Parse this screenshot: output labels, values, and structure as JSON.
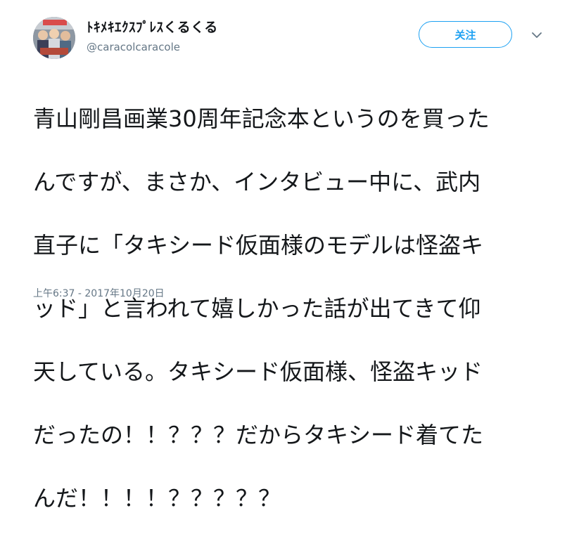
{
  "user": {
    "display_name": "ﾄｷﾒｷｴｸｽﾌﾟﾚｽくるくる",
    "handle": "@caracolcaracole"
  },
  "actions": {
    "follow_label": "关注",
    "menu_icon": "chevron-down-icon"
  },
  "tweet": {
    "lines": [
      "青山剛昌画業30周年記念本というのを買った",
      "んですが、まさか、インタビュー中に、武内",
      "直子に「タキシード仮面様のモデルは怪盗キ",
      "ッド」と言われて嬉しかった話が出てきて仰",
      "天している。タキシード仮面様、怪盗キッド",
      "だったの！！？？？だからタキシード着てた",
      "んだ！！！！？？？？？"
    ],
    "timestamp": "上午6:37 - 2017年10月20日"
  },
  "colors": {
    "accent": "#1da1f2",
    "secondary_text": "#657786",
    "primary_text": "#14171a"
  }
}
